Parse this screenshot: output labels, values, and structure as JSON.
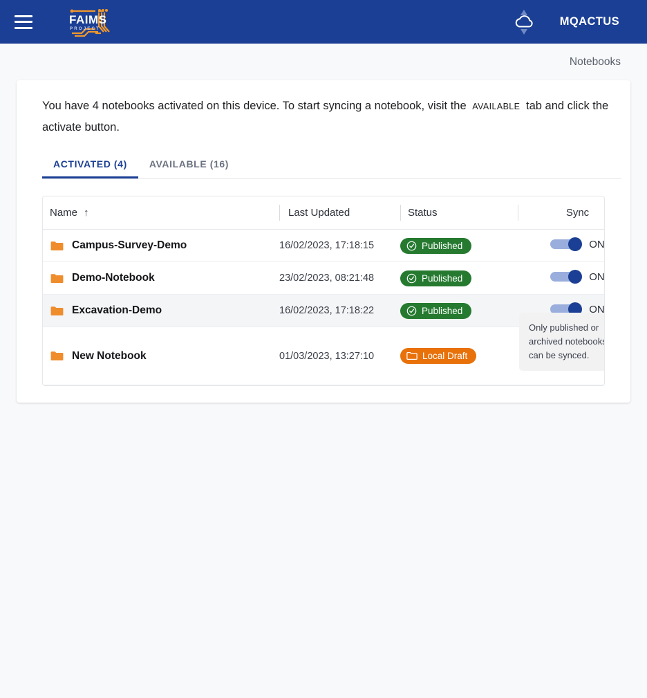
{
  "appbar": {
    "menu_icon": "hamburger-menu-icon",
    "logo_primary": "FAIMS",
    "logo_secondary": "P R O J E C T",
    "sync_icon": "cloud-sync-icon",
    "username": "MQACTUS",
    "background_color": "#1b3f94"
  },
  "breadcrumb": {
    "label": "Notebooks"
  },
  "intro": {
    "part1": "You have 4 notebooks activated on this device. To start syncing a notebook, visit the",
    "chip": "AVAILABLE",
    "part2": "tab and click the activate button."
  },
  "tabs": [
    {
      "label": "ACTIVATED (4)",
      "active": true,
      "name": "tab-activated"
    },
    {
      "label": "AVAILABLE (16)",
      "active": false,
      "name": "tab-available"
    }
  ],
  "table": {
    "columns": [
      {
        "label": "Name",
        "sort": "↑"
      },
      {
        "label": "Last Updated"
      },
      {
        "label": "Status"
      },
      {
        "label": "Sync"
      }
    ],
    "rows": [
      {
        "name": "Campus-Survey-Demo",
        "last_updated": "16/02/2023, 17:18:15",
        "status": "Published",
        "status_type": "published",
        "sync": "ON",
        "sync_on": true,
        "highlight": false
      },
      {
        "name": "Demo-Notebook",
        "last_updated": "23/02/2023, 08:21:48",
        "status": "Published",
        "status_type": "published",
        "sync": "ON",
        "sync_on": true,
        "highlight": false
      },
      {
        "name": "Excavation-Demo",
        "last_updated": "16/02/2023, 17:18:22",
        "status": "Published",
        "status_type": "published",
        "sync": "ON",
        "sync_on": true,
        "highlight": true
      },
      {
        "name": "New Notebook",
        "last_updated": "01/03/2023, 13:27:10",
        "status": "Local Draft",
        "status_type": "draft",
        "sync": "",
        "sync_on": false,
        "highlight": false,
        "tooltip": "Only published or archived notebooks can be synced."
      }
    ]
  },
  "colors": {
    "brand_blue": "#1b3f94",
    "published_green": "#257a30",
    "draft_orange": "#e8710a",
    "folder_orange": "#ef8c2c",
    "page_background": "#f8f9fb"
  }
}
